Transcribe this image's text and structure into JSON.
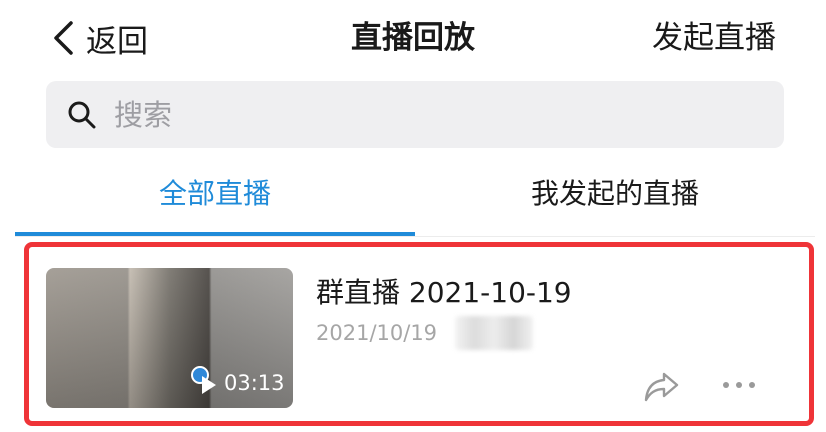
{
  "nav": {
    "back_label": "返回",
    "title": "直播回放",
    "action_label": "发起直播"
  },
  "search": {
    "placeholder": "搜索",
    "value": ""
  },
  "tabs": [
    {
      "label": "全部直播",
      "active": true
    },
    {
      "label": "我发起的直播",
      "active": false
    }
  ],
  "colors": {
    "accent": "#1f8bd9",
    "highlight_border": "#ef3438",
    "search_bg": "#efeff1"
  },
  "replays": [
    {
      "title": "群直播 2021-10-19",
      "date": "2021/10/19",
      "duration": "03:13",
      "icons": [
        "play-icon",
        "share-icon",
        "more-icon"
      ]
    }
  ]
}
